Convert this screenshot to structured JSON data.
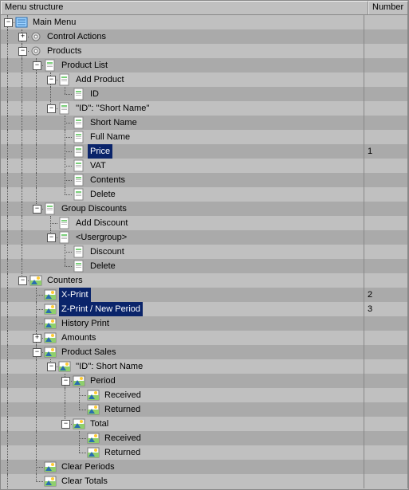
{
  "columns": {
    "structure": "Menu structure",
    "number": "Number"
  },
  "icons": {
    "menu": {
      "bg": "#9fd3ff",
      "fg": "#2a6db0"
    },
    "gear": {
      "bg": "#d9d9d9",
      "fg": "#777"
    },
    "page": {
      "bg": "#fff",
      "fg": "#888",
      "bar": "#7bd07b"
    },
    "photo": {
      "bg": "#8fcf6d",
      "fg": "#2a6db0"
    }
  },
  "rows": [
    {
      "depth": 0,
      "exp": "minus",
      "icon": "menu",
      "label": "Main Menu",
      "number": "",
      "selected": false,
      "last": false,
      "anc": []
    },
    {
      "depth": 1,
      "exp": "plus",
      "icon": "gear",
      "label": "Control Actions",
      "number": "",
      "selected": false,
      "last": false,
      "anc": [
        1
      ]
    },
    {
      "depth": 1,
      "exp": "minus",
      "icon": "gear",
      "label": "Products",
      "number": "",
      "selected": false,
      "last": false,
      "anc": [
        1
      ]
    },
    {
      "depth": 2,
      "exp": "minus",
      "icon": "page",
      "label": "Product List",
      "number": "",
      "selected": false,
      "last": false,
      "anc": [
        1,
        1
      ]
    },
    {
      "depth": 3,
      "exp": "minus",
      "icon": "page",
      "label": "Add Product",
      "number": "",
      "selected": false,
      "last": false,
      "anc": [
        1,
        1,
        1
      ]
    },
    {
      "depth": 4,
      "exp": "none",
      "icon": "page",
      "label": "ID",
      "number": "",
      "selected": false,
      "last": true,
      "anc": [
        1,
        1,
        1,
        1
      ]
    },
    {
      "depth": 3,
      "exp": "minus",
      "icon": "page",
      "label": "''ID'': ''Short Name''",
      "number": "",
      "selected": false,
      "last": true,
      "anc": [
        1,
        1,
        1
      ]
    },
    {
      "depth": 4,
      "exp": "none",
      "icon": "page",
      "label": "Short Name",
      "number": "",
      "selected": false,
      "last": false,
      "anc": [
        1,
        1,
        1,
        0
      ]
    },
    {
      "depth": 4,
      "exp": "none",
      "icon": "page",
      "label": "Full Name",
      "number": "",
      "selected": false,
      "last": false,
      "anc": [
        1,
        1,
        1,
        0
      ]
    },
    {
      "depth": 4,
      "exp": "none",
      "icon": "page",
      "label": "Price",
      "number": "1",
      "selected": true,
      "last": false,
      "anc": [
        1,
        1,
        1,
        0
      ]
    },
    {
      "depth": 4,
      "exp": "none",
      "icon": "page",
      "label": "VAT",
      "number": "",
      "selected": false,
      "last": false,
      "anc": [
        1,
        1,
        1,
        0
      ]
    },
    {
      "depth": 4,
      "exp": "none",
      "icon": "page",
      "label": "Contents",
      "number": "",
      "selected": false,
      "last": false,
      "anc": [
        1,
        1,
        1,
        0
      ]
    },
    {
      "depth": 4,
      "exp": "none",
      "icon": "page",
      "label": "Delete",
      "number": "",
      "selected": false,
      "last": true,
      "anc": [
        1,
        1,
        1,
        0
      ]
    },
    {
      "depth": 2,
      "exp": "minus",
      "icon": "page",
      "label": "Group Discounts",
      "number": "",
      "selected": false,
      "last": true,
      "anc": [
        1,
        1
      ]
    },
    {
      "depth": 3,
      "exp": "none",
      "icon": "page",
      "label": "Add Discount",
      "number": "",
      "selected": false,
      "last": false,
      "anc": [
        1,
        1,
        0
      ]
    },
    {
      "depth": 3,
      "exp": "minus",
      "icon": "page",
      "label": "<Usergroup>",
      "number": "",
      "selected": false,
      "last": true,
      "anc": [
        1,
        1,
        0
      ]
    },
    {
      "depth": 4,
      "exp": "none",
      "icon": "page",
      "label": "Discount",
      "number": "",
      "selected": false,
      "last": false,
      "anc": [
        1,
        1,
        0,
        0
      ]
    },
    {
      "depth": 4,
      "exp": "none",
      "icon": "page",
      "label": "Delete",
      "number": "",
      "selected": false,
      "last": true,
      "anc": [
        1,
        1,
        0,
        0
      ]
    },
    {
      "depth": 1,
      "exp": "minus",
      "icon": "photo",
      "label": "Counters",
      "number": "",
      "selected": false,
      "last": true,
      "anc": [
        1
      ]
    },
    {
      "depth": 2,
      "exp": "none",
      "icon": "photo",
      "label": "X-Print",
      "number": "2",
      "selected": true,
      "last": false,
      "anc": [
        1,
        0
      ]
    },
    {
      "depth": 2,
      "exp": "none",
      "icon": "photo",
      "label": "Z-Print / New Period",
      "number": "3",
      "selected": true,
      "last": false,
      "anc": [
        1,
        0
      ]
    },
    {
      "depth": 2,
      "exp": "none",
      "icon": "photo",
      "label": "History Print",
      "number": "",
      "selected": false,
      "last": false,
      "anc": [
        1,
        0
      ]
    },
    {
      "depth": 2,
      "exp": "plus",
      "icon": "photo",
      "label": "Amounts",
      "number": "",
      "selected": false,
      "last": false,
      "anc": [
        1,
        0
      ]
    },
    {
      "depth": 2,
      "exp": "minus",
      "icon": "photo",
      "label": "Product Sales",
      "number": "",
      "selected": false,
      "last": false,
      "anc": [
        1,
        0
      ]
    },
    {
      "depth": 3,
      "exp": "minus",
      "icon": "photo",
      "label": "''ID'': Short Name",
      "number": "",
      "selected": false,
      "last": true,
      "anc": [
        1,
        0,
        1
      ]
    },
    {
      "depth": 4,
      "exp": "minus",
      "icon": "photo",
      "label": "Period",
      "number": "",
      "selected": false,
      "last": false,
      "anc": [
        1,
        0,
        1,
        0
      ]
    },
    {
      "depth": 5,
      "exp": "none",
      "icon": "photo",
      "label": "Received",
      "number": "",
      "selected": false,
      "last": false,
      "anc": [
        1,
        0,
        1,
        0,
        1
      ]
    },
    {
      "depth": 5,
      "exp": "none",
      "icon": "photo",
      "label": "Returned",
      "number": "",
      "selected": false,
      "last": true,
      "anc": [
        1,
        0,
        1,
        0,
        1
      ]
    },
    {
      "depth": 4,
      "exp": "minus",
      "icon": "photo",
      "label": "Total",
      "number": "",
      "selected": false,
      "last": true,
      "anc": [
        1,
        0,
        1,
        0
      ]
    },
    {
      "depth": 5,
      "exp": "none",
      "icon": "photo",
      "label": "Received",
      "number": "",
      "selected": false,
      "last": false,
      "anc": [
        1,
        0,
        1,
        0,
        0
      ]
    },
    {
      "depth": 5,
      "exp": "none",
      "icon": "photo",
      "label": "Returned",
      "number": "",
      "selected": false,
      "last": true,
      "anc": [
        1,
        0,
        1,
        0,
        0
      ]
    },
    {
      "depth": 2,
      "exp": "none",
      "icon": "photo",
      "label": "Clear Periods",
      "number": "",
      "selected": false,
      "last": false,
      "anc": [
        1,
        0
      ]
    },
    {
      "depth": 2,
      "exp": "none",
      "icon": "photo",
      "label": "Clear Totals",
      "number": "",
      "selected": false,
      "last": true,
      "anc": [
        1,
        0
      ]
    }
  ]
}
